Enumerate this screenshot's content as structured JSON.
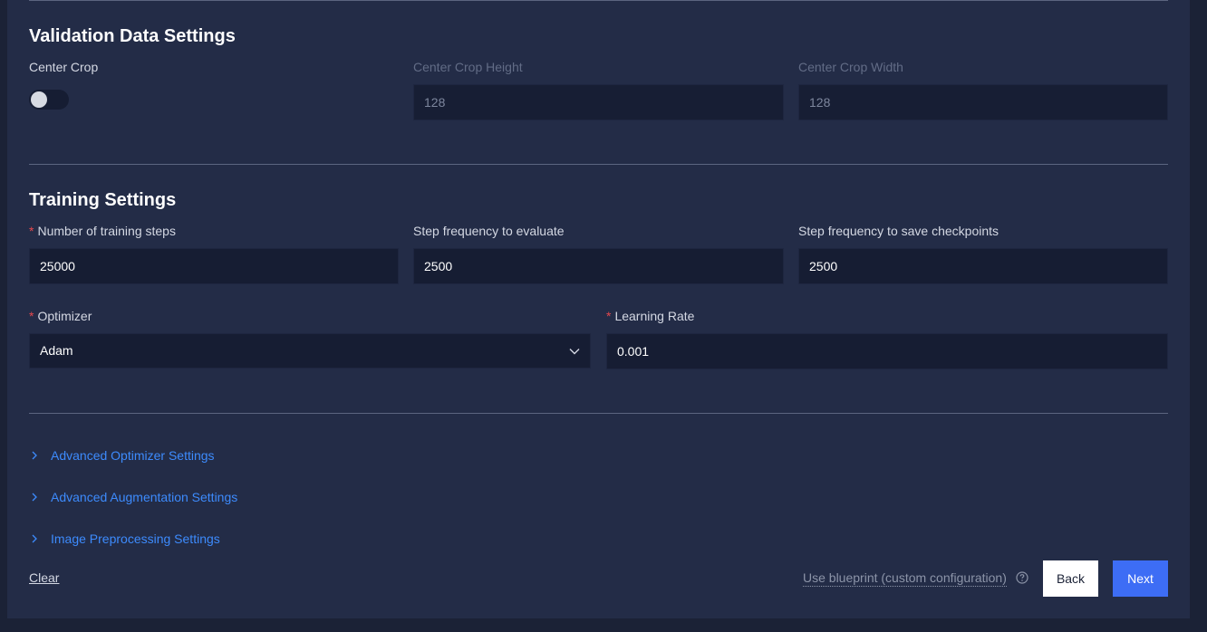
{
  "validation": {
    "title": "Validation Data Settings",
    "center_crop_label": "Center Crop",
    "center_crop_enabled": false,
    "crop_height_label": "Center Crop Height",
    "crop_height_value": "128",
    "crop_width_label": "Center Crop Width",
    "crop_width_value": "128"
  },
  "training": {
    "title": "Training Settings",
    "steps_label": "Number of training steps",
    "steps_value": "25000",
    "eval_freq_label": "Step frequency to evaluate",
    "eval_freq_value": "2500",
    "ckpt_freq_label": "Step frequency to save checkpoints",
    "ckpt_freq_value": "2500",
    "optimizer_label": "Optimizer",
    "optimizer_value": "Adam",
    "lr_label": "Learning Rate",
    "lr_value": "0.001",
    "required_mark": "*"
  },
  "collapsibles": [
    {
      "label": "Advanced Optimizer Settings"
    },
    {
      "label": "Advanced Augmentation Settings"
    },
    {
      "label": "Image Preprocessing Settings"
    }
  ],
  "footer": {
    "clear_label": "Clear",
    "blueprint_label": "Use blueprint (custom configuration)",
    "back_label": "Back",
    "next_label": "Next"
  },
  "icons": {
    "chevron_right": "chevron-right-icon",
    "chevron_down": "chevron-down-icon",
    "help": "help-circle-icon"
  },
  "colors": {
    "accent": "#3d6df5",
    "link": "#3d8bfd",
    "required": "#e5484d",
    "background": "#232c47"
  }
}
